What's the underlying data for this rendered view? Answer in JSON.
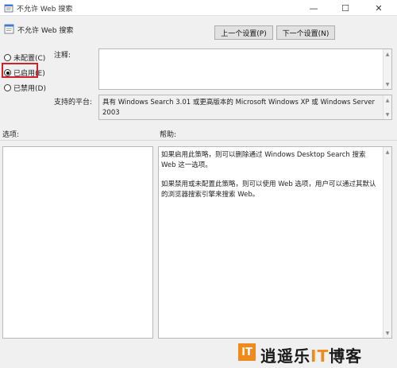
{
  "window": {
    "title": "不允许 Web 搜索",
    "min_symbol": "—",
    "max_symbol": "☐",
    "close_symbol": "✕"
  },
  "header": {
    "policy_name": "不允许 Web 搜索",
    "prev_button": "上一个设置(P)",
    "next_button": "下一个设置(N)"
  },
  "state": {
    "options": [
      {
        "label": "未配置(C)",
        "checked": false
      },
      {
        "label": "已启用(E)",
        "checked": true
      },
      {
        "label": "已禁用(D)",
        "checked": false
      }
    ],
    "highlight_color": "#d0202a"
  },
  "comment": {
    "label": "注释:",
    "value": ""
  },
  "platform": {
    "label": "支持的平台:",
    "value": "具有 Windows Search 3.01 或更高版本的 Microsoft Windows XP 或 Windows Server 2003"
  },
  "options_section": {
    "label": "选项:"
  },
  "help_section": {
    "label": "帮助:",
    "paragraphs": [
      "如果启用此策略，则可以删除通过 Windows Desktop Search 搜索 Web 这一选项。",
      "如果禁用或未配置此策略，则可以使用 Web 选项，用户可以通过其默认的浏览器搜索引擎来搜索 Web。"
    ]
  },
  "watermark": {
    "logo_letter": "IT",
    "text_part1": "逍遥乐",
    "text_part2": "IT",
    "text_part3": "博客",
    "accent_color": "#f08a1c"
  }
}
